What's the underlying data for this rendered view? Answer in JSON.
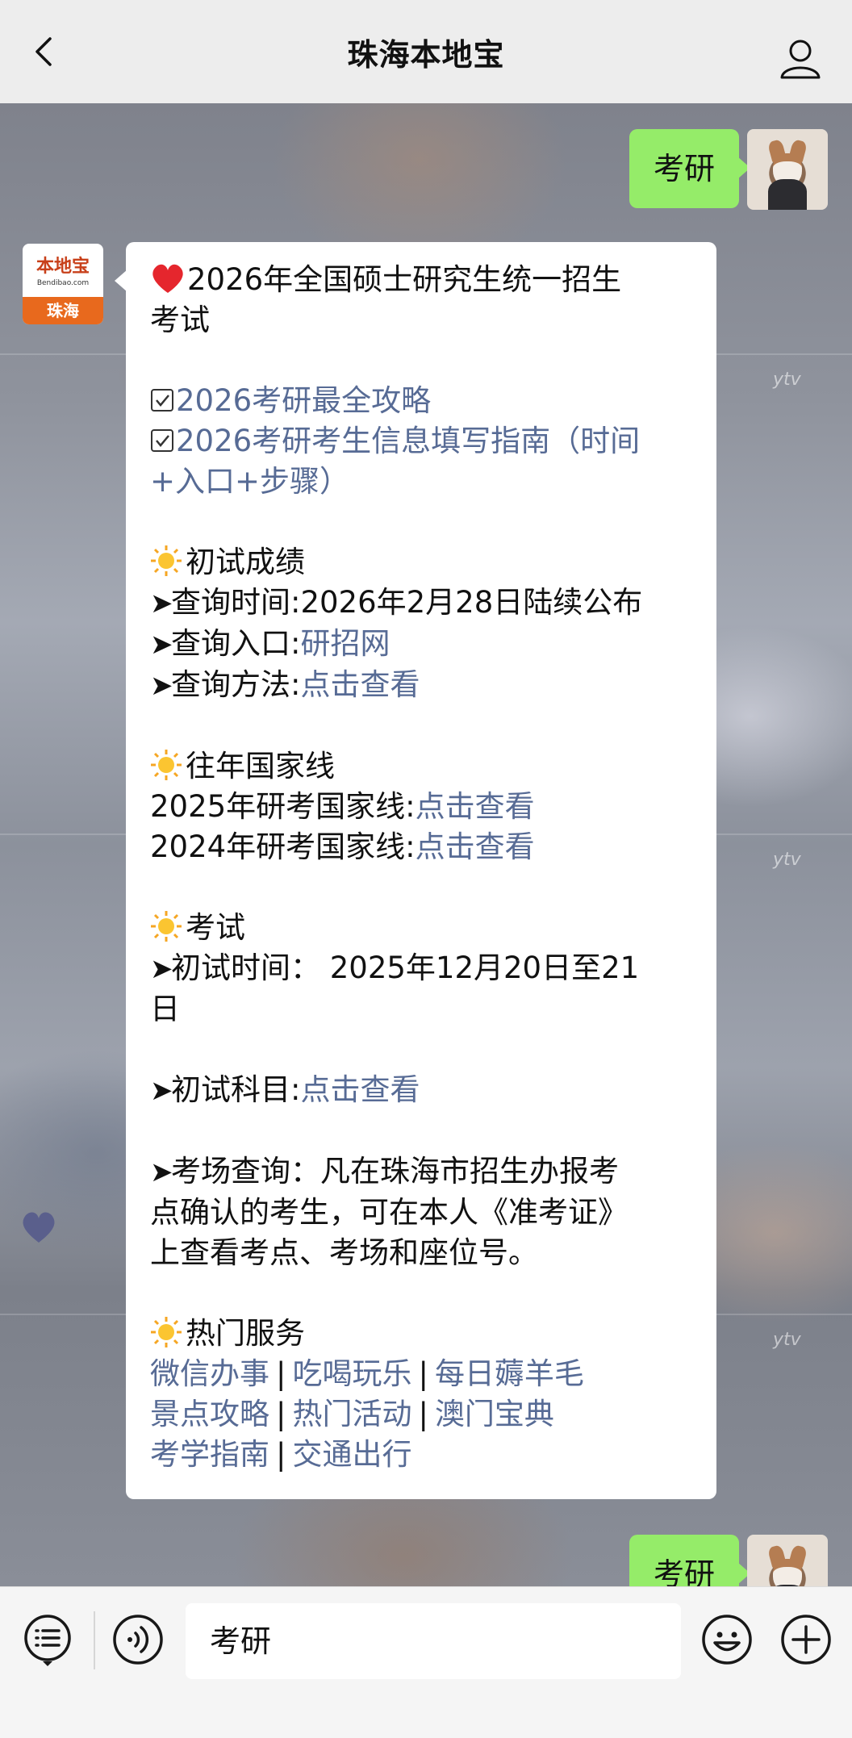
{
  "header": {
    "title": "珠海本地宝",
    "back_icon": "chevron-left-icon",
    "profile_icon": "person-icon"
  },
  "messages": {
    "user_query_1": "考研",
    "user_query_2": "考研",
    "bot_avatar": {
      "brand": "本地宝",
      "site": "Bendibao.com",
      "city": "珠海"
    },
    "reply": {
      "headline_1": "2026年全国硕士研究生统一招生",
      "headline_2": "考试",
      "link_guide": "2026考研最全攻略",
      "link_info_1": "2026考研考生信息填写指南（时间",
      "link_info_2": "+入口+步骤）",
      "sec_score": "初试成绩",
      "score_time": "查询时间:2026年2月28日陆续公布",
      "score_entry_label": "查询入口:",
      "score_entry_link": "研招网",
      "score_method_label": "查询方法:",
      "score_method_link": "点击查看",
      "sec_lines": "往年国家线",
      "line_2025_label": "2025年研考国家线:",
      "line_2025_link": "点击查看",
      "line_2024_label": "2024年研考国家线:",
      "line_2024_link": "点击查看",
      "sec_exam": "考试",
      "exam_time_1": "初试时间：  2025年12月20日至21",
      "exam_time_2": "日",
      "exam_subject_label": "初试科目:",
      "exam_subject_link": "点击查看",
      "venue_1": "考场查询：凡在珠海市招生办报考",
      "venue_2": "点确认的考生，可在本人《准考证》",
      "venue_3": "上查看考点、考场和座位号。",
      "sec_services": "热门服务",
      "services": [
        "微信办事",
        "吃喝玩乐",
        "每日薅羊毛",
        "景点攻略",
        "热门活动",
        "澳门宝典",
        "考学指南",
        "交通出行"
      ]
    }
  },
  "wallpaper_watermark": "ytv",
  "input_bar": {
    "menu_icon": "menu-list-icon",
    "voice_icon": "voice-icon",
    "text": "考研",
    "emoji_icon": "emoji-icon",
    "plus_icon": "plus-icon"
  },
  "colors": {
    "link": "#576b95",
    "self_bubble": "#95ec69",
    "header_bg": "#ededed"
  }
}
